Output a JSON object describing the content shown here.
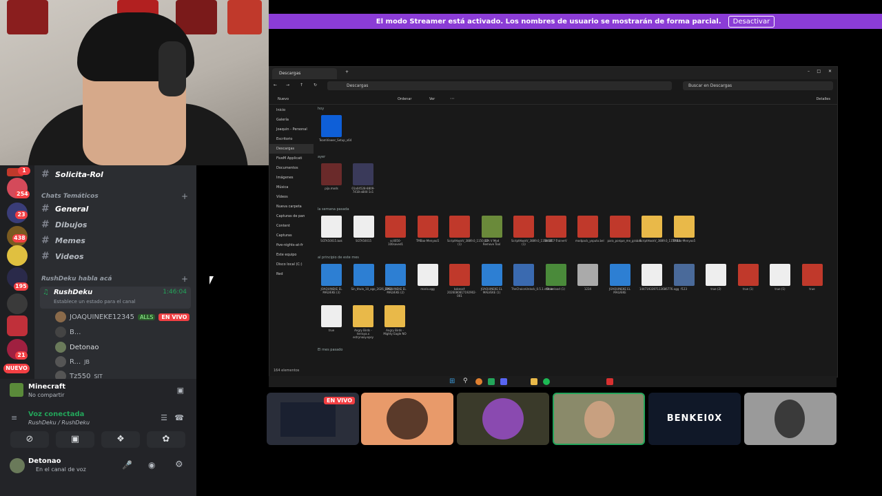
{
  "streamer_banner": {
    "message": "El modo Streamer está activado. Los nombres de usuario se mostrarán de forma parcial.",
    "button": "Desactivar"
  },
  "servers": {
    "badges": [
      "1",
      "254",
      "23",
      "438",
      "195",
      "21"
    ],
    "new_label": "NUEVO"
  },
  "channels": {
    "top": "Solicita-Rol",
    "cat1": "Chats Temáticos",
    "items": [
      "General",
      "Dibujos",
      "Memes",
      "Videos"
    ],
    "cat2": "RushDeku habla acá",
    "voice": {
      "name": "RushDeku",
      "time": "1:46:04",
      "status": "Establece un estado para el canal",
      "users": [
        {
          "name": "JOAQUINEKE12345",
          "tag": "ALLS",
          "live": "EN VIVO"
        },
        {
          "name": "B..."
        },
        {
          "name": "Detonao"
        },
        {
          "name": "R...",
          "tag": "JB"
        },
        {
          "name": "Tz550",
          "tag": "SIT"
        }
      ]
    }
  },
  "activity": {
    "game": "Minecraft",
    "sub": "No compartir"
  },
  "voice_panel": {
    "status": "Voz conectada",
    "channel": "RushDeku / RushDeku"
  },
  "user_panel": {
    "name": "Detonao",
    "sub": "En el canal de voz"
  },
  "explorer": {
    "tab": "Descargas",
    "path": "Descargas",
    "search": "Buscar en Descargas",
    "new_btn": "Nuevo",
    "sort_btn": "Ordenar",
    "view_btn": "Ver",
    "details_btn": "Detalles",
    "nav": [
      "Inicio",
      "Galería",
      "Joaquin - Personal",
      "Escritorio",
      "Descargas",
      "FiveM Applicati",
      "Documentos",
      "Imágenes",
      "Música",
      "Vídeos",
      "Nueva carpeta",
      "Capturas de pan",
      "Content",
      "Capturas",
      "five-nights-at-fr",
      "Este equipo",
      "Disco local (C:)",
      "Red"
    ],
    "groups": [
      "hoy",
      "ayer",
      "la semana pasada",
      "al principio de este mes",
      "El mes pasado"
    ],
    "files_today": [
      "TeamViewer_Setup_x64"
    ],
    "files_yesterday": [
      "pija.mods",
      "01a04528-8809-7418-a844-1c1"
    ],
    "files_lastweek": [
      "SGTA50015.bak",
      "SGTA50015",
      "sc4050-100saved1",
      "TMBao-Menyoo5",
      "ScriptHookV_3889.0_1150.13 (1)",
      "GTA V Mod Remove Tool",
      "ScriptHookV_3889.0_1150.13 (1)",
      "0x9857-TrainerV",
      "modpack_yoputo.bel",
      "para_porque_me_grabas",
      "ScriptHookV_3889.0_1150.13",
      "TMBao-Menyoo5"
    ],
    "files_month": [
      "JOAQUINEKE EL MALVEKE (3)",
      "Sin_titulo_10_ago_2026_1954",
      "JOAQUINEKE EL MALVEKE (2)",
      "mario.ogg",
      "kokesaf-2026080817192902-001",
      "JOAQUINEKE EL MALVEKE (1)",
      "TheChoiceUnlock_0.5.1.stable",
      "Download (1)",
      "1234",
      "JOAQUINEKE EL MALVEKE",
      "1447193397113686776.ogg",
      "f123",
      "true (2)",
      "true (1)",
      "true (1)",
      "true",
      "true",
      "Angry Birds - terraya.x estrynoxy.epsy",
      "Angry Birds - Mighty Eagle NO"
    ],
    "status": "164 elementos"
  },
  "tiles": {
    "live": "EN VIVO",
    "benkeiox": "BENKEI0X"
  },
  "colors": {
    "streamer": "#8b3cd6",
    "live": "#f23f43",
    "green": "#23a55a",
    "rar": "#c0392b",
    "folder": "#e9b949",
    "audio": "#2d7fd3"
  }
}
